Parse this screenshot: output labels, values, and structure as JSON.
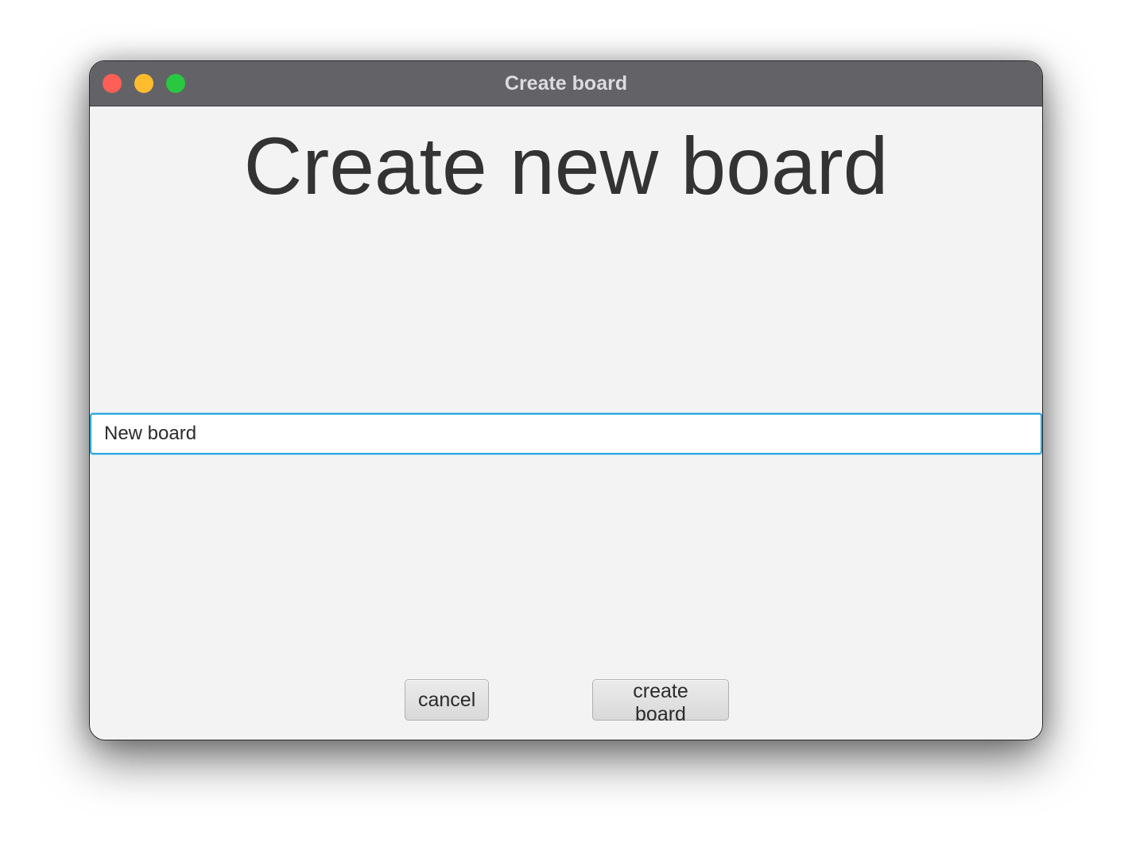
{
  "window": {
    "title": "Create board",
    "controls": {
      "close": "traffic-light-red",
      "minimize": "traffic-light-yellow",
      "maximize": "traffic-light-green"
    }
  },
  "main": {
    "heading": "Create new board",
    "board_name_value": "New board"
  },
  "actions": {
    "cancel_label": "cancel",
    "create_label": "create board"
  },
  "colors": {
    "titlebar": "#636267",
    "background": "#f3f3f3",
    "focus_ring": "#2ba6dd",
    "close": "#fe5f57",
    "minimize": "#febc2e",
    "maximize": "#28c840"
  }
}
